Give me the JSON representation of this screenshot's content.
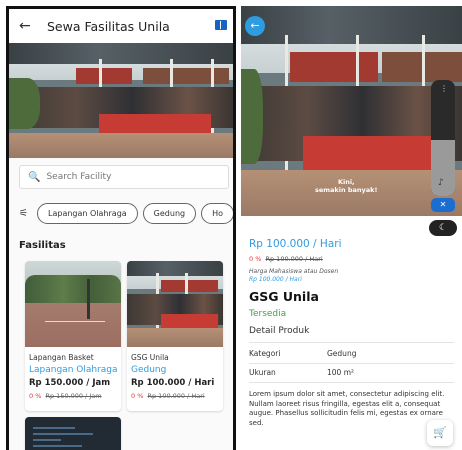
{
  "left_screen": {
    "header": {
      "back_icon": "←",
      "title": "Sewa Fasilitas Unila",
      "menu_icon": "book-icon"
    },
    "search": {
      "placeholder": "Search Facility",
      "icon": "🔍"
    },
    "filters": {
      "clear_icon": "⚟",
      "chips": [
        "Lapangan Olahraga",
        "Gedung",
        "Ho"
      ]
    },
    "section_title": "Fasilitas",
    "cards": [
      {
        "name": "Lapangan Basket",
        "category": "Lapangan Olahraga",
        "price": "Rp 150.000 / Jam",
        "discount": "0 %",
        "original_price": "Rp 150.000 / Jam"
      },
      {
        "name": "GSG Unila",
        "category": "Gedung",
        "price": "Rp 100.000 / Hari",
        "discount": "0 %",
        "original_price": "Rp 100.000 / Hari"
      }
    ]
  },
  "right_screen": {
    "back_icon": "←",
    "photo_caption": "Kini,\nsemakin banyak!",
    "volume_dots": "⋮",
    "music_icon": "♪",
    "mute_icon": "🔇",
    "theme_icon": "☾",
    "price": "Rp 100.000 / Hari",
    "discount": "0 %",
    "original_price": "Rp 100.000 / Hari",
    "student_label": "Harga Mahasiswa atau Dosen",
    "student_price": "Rp 100.000 / Hari",
    "name": "GSG Unila",
    "status": "Tersedia",
    "detail_title": "Detail Produk",
    "details": [
      {
        "label": "Kategori",
        "value": "Gedung"
      },
      {
        "label": "Ukuran",
        "value": "100 m²"
      }
    ],
    "description": "Lorem ipsum dolor sit amet, consectetur adipiscing elit. Nullam laoreet risus fringilla, egestas elit a, consequat augue. Phasellus sollicitudin felis mi, egestas ex ornare sed.",
    "cart_icon": "🛒"
  },
  "colors": {
    "accent_blue": "#2f9be0",
    "status_green": "#43a047",
    "discount_red": "#ee3333"
  }
}
